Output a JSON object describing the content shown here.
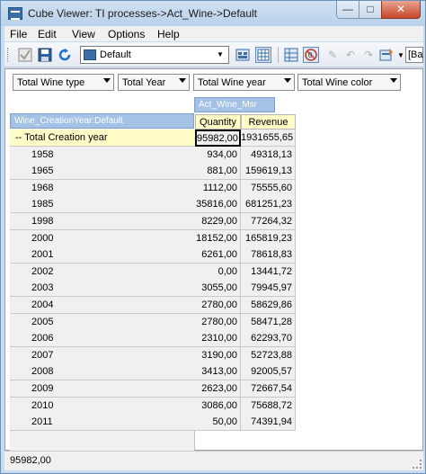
{
  "window": {
    "title": "Cube Viewer: TI processes->Act_Wine->Default",
    "minimize_label": "—",
    "maximize_label": "□",
    "close_label": "✕"
  },
  "menu": [
    "File",
    "Edit",
    "View",
    "Options",
    "Help"
  ],
  "toolbar": {
    "view_name": "Default",
    "truncated_button": "[Ba",
    "icons": [
      "checkbox-icon",
      "save-icon",
      "refresh-icon",
      "view-icon",
      "grid-icon",
      "zero-suppress-icon",
      "sandbox-icon",
      "undo-icon",
      "redo-icon",
      "data-icon"
    ]
  },
  "dimensions": [
    {
      "label": "Total Wine type"
    },
    {
      "label": "Total Year"
    },
    {
      "label": "Total Wine year"
    },
    {
      "label": "Total Wine color"
    }
  ],
  "column_dimension": "Act_Wine_Msr",
  "row_dimension": "Wine_CreationYear:Default",
  "columns": [
    "Quantity",
    "Revenue"
  ],
  "rows": [
    {
      "label": "-- Total Creation year",
      "quantity": "95982,00",
      "revenue": "1931655,65"
    },
    {
      "label": "1958",
      "quantity": "934,00",
      "revenue": "49318,13"
    },
    {
      "label": "1965",
      "quantity": "881,00",
      "revenue": "159619,13"
    },
    {
      "label": "1968",
      "quantity": "1112,00",
      "revenue": "75555,60"
    },
    {
      "label": "1985",
      "quantity": "35816,00",
      "revenue": "681251,23"
    },
    {
      "label": "1998",
      "quantity": "8229,00",
      "revenue": "77264,32"
    },
    {
      "label": "2000",
      "quantity": "18152,00",
      "revenue": "165819,23"
    },
    {
      "label": "2001",
      "quantity": "6261,00",
      "revenue": "78618,83"
    },
    {
      "label": "2002",
      "quantity": "0,00",
      "revenue": "13441,72"
    },
    {
      "label": "2003",
      "quantity": "3055,00",
      "revenue": "79945,97"
    },
    {
      "label": "2004",
      "quantity": "2780,00",
      "revenue": "58629,86"
    },
    {
      "label": "2005",
      "quantity": "2780,00",
      "revenue": "58471,28"
    },
    {
      "label": "2006",
      "quantity": "2310,00",
      "revenue": "62293,70"
    },
    {
      "label": "2007",
      "quantity": "3190,00",
      "revenue": "52723,88"
    },
    {
      "label": "2008",
      "quantity": "3413,00",
      "revenue": "92005,57"
    },
    {
      "label": "2009",
      "quantity": "2623,00",
      "revenue": "72667,54"
    },
    {
      "label": "2010",
      "quantity": "3086,00",
      "revenue": "75688,72"
    },
    {
      "label": "2011",
      "quantity": "50,00",
      "revenue": "74391,94"
    }
  ],
  "status": {
    "text": "95982,00"
  },
  "colors": {
    "header_blue": "#a4c2e6",
    "total_yellow": "#fffcc8",
    "cell_gray": "#f0f0f0"
  }
}
